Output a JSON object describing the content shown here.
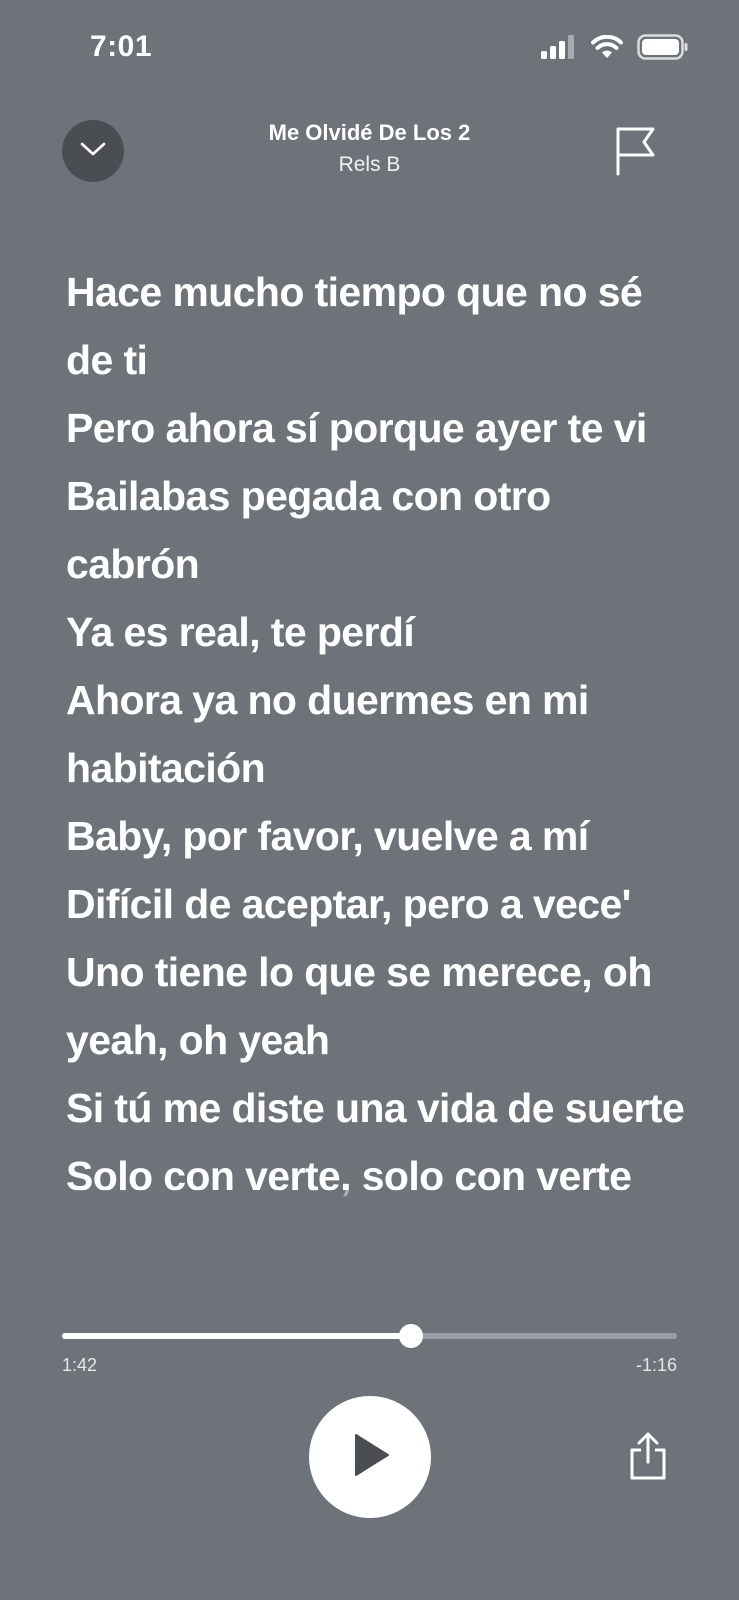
{
  "status_bar": {
    "time": "7:01"
  },
  "header": {
    "title": "Me Olvidé De Los 2",
    "artist": "Rels B"
  },
  "lyrics": {
    "lines": [
      "Hace mucho tiempo que no sé de ti",
      "Pero ahora sí porque ayer te vi",
      "Bailabas pegada con otro cabrón",
      "Ya es real, te perdí",
      "Ahora ya no duermes en mi habitación",
      "Baby, por favor, vuelve a mí",
      "Difícil de aceptar, pero a vece'",
      "Uno tiene lo que se merece, oh yeah, oh yeah",
      "Si tú me diste una vida de suerte",
      "Solo con verte, solo con verte"
    ]
  },
  "player": {
    "elapsed": "1:42",
    "remaining": "-1:16",
    "progress_fraction": 0.568
  },
  "icons": {
    "collapse": "chevron-down-icon",
    "report": "flag-icon",
    "play": "play-icon",
    "share": "share-icon"
  },
  "colors": {
    "background": "#6e737a",
    "collapse_button": "#4a4d52",
    "text": "#ffffff"
  }
}
